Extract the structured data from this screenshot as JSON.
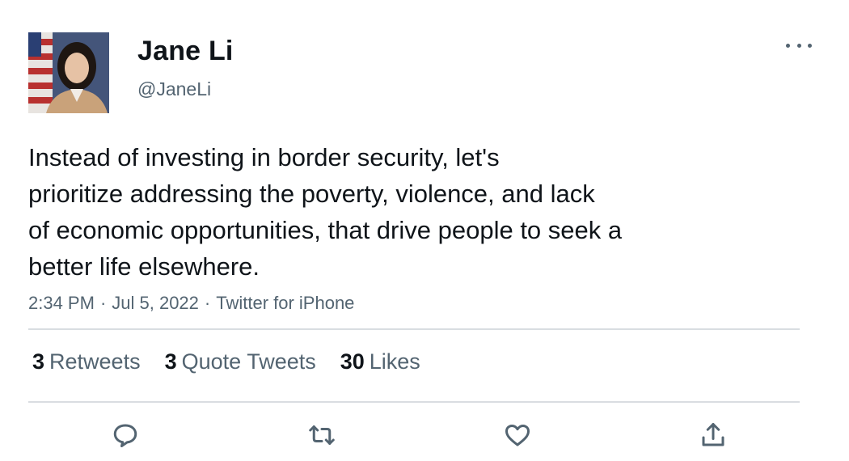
{
  "author": {
    "name": "Jane Li",
    "handle": "@JaneLi",
    "avatar_alt": "profile photo"
  },
  "tweet": {
    "lines": [
      "Instead of investing in border security, let's",
      "prioritize addressing the poverty, violence, and lack",
      "of economic opportunities, that drive people to seek a",
      "better life elsewhere."
    ],
    "time": "2:34 PM",
    "date": "Jul 5, 2022",
    "source": "Twitter for iPhone",
    "separator": "·"
  },
  "stats": {
    "retweets": {
      "count": "3",
      "label": "Retweets"
    },
    "quotes": {
      "count": "3",
      "label": "Quote Tweets"
    },
    "likes": {
      "count": "30",
      "label": "Likes"
    }
  },
  "actions": [
    {
      "name": "reply-icon"
    },
    {
      "name": "retweet-icon"
    },
    {
      "name": "like-icon"
    },
    {
      "name": "share-icon"
    }
  ],
  "colors": {
    "text": "#0f1419",
    "secondary": "#536471",
    "divider": "#d9dde1"
  }
}
